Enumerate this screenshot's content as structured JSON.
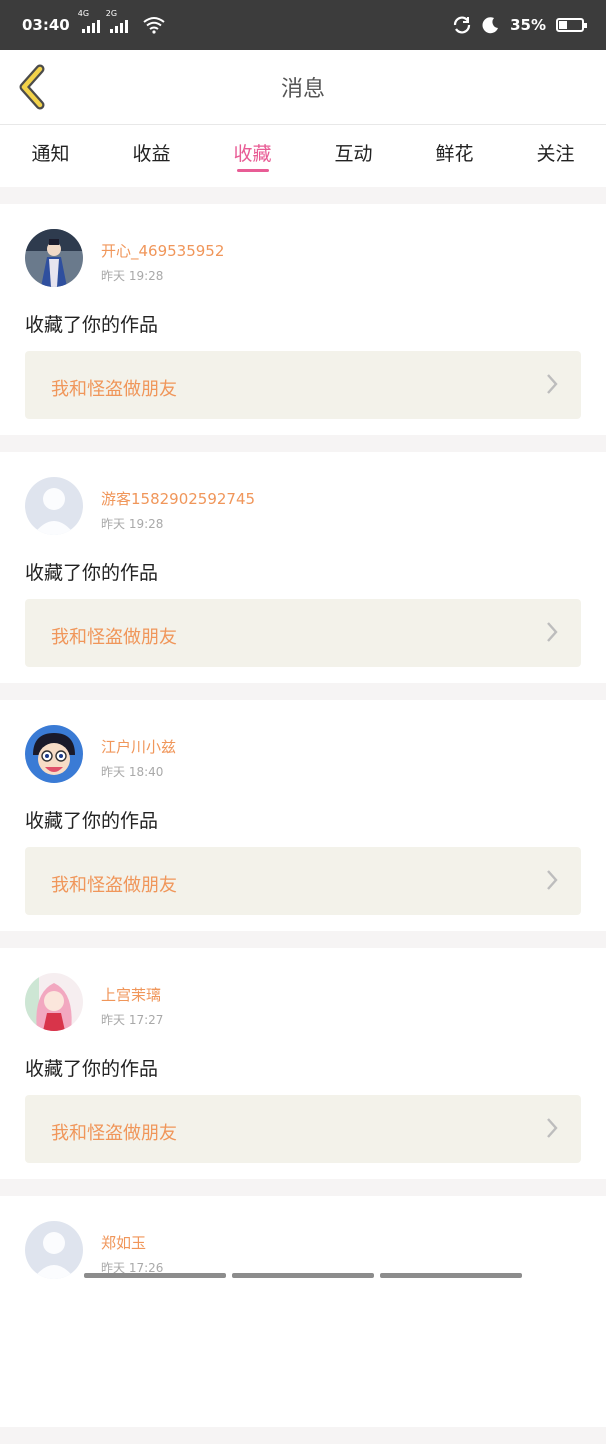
{
  "status_bar": {
    "time": "03:40",
    "signal1": "4G",
    "signal2": "2G",
    "battery_text": "35%",
    "battery_level": 0.35
  },
  "header": {
    "title": "消息"
  },
  "tabs": [
    "通知",
    "收益",
    "收藏",
    "互动",
    "鲜花",
    "关注"
  ],
  "active_tab": 2,
  "messages": [
    {
      "name": "开心_469535952",
      "time": "昨天 19:28",
      "action": "收藏了你的作品",
      "work": "我和怪盗做朋友",
      "avatar": "photo-girl"
    },
    {
      "name": "游客1582902592745",
      "time": "昨天 19:28",
      "action": "收藏了你的作品",
      "work": "我和怪盗做朋友",
      "avatar": "default-user"
    },
    {
      "name": "江户川小兹",
      "time": "昨天 18:40",
      "action": "收藏了你的作品",
      "work": "我和怪盗做朋友",
      "avatar": "anime-boy"
    },
    {
      "name": "上宫茉璃",
      "time": "昨天 17:27",
      "action": "收藏了你的作品",
      "work": "我和怪盗做朋友",
      "avatar": "anime-girl"
    },
    {
      "name": "郑如玉",
      "time": "昨天 17:26",
      "action": "",
      "work": "",
      "avatar": "default-user"
    }
  ],
  "colors": {
    "accent": "#e85c95",
    "username": "#f0965a",
    "work_bg": "#f3f2ea",
    "status_bar": "#3c3c3c"
  }
}
